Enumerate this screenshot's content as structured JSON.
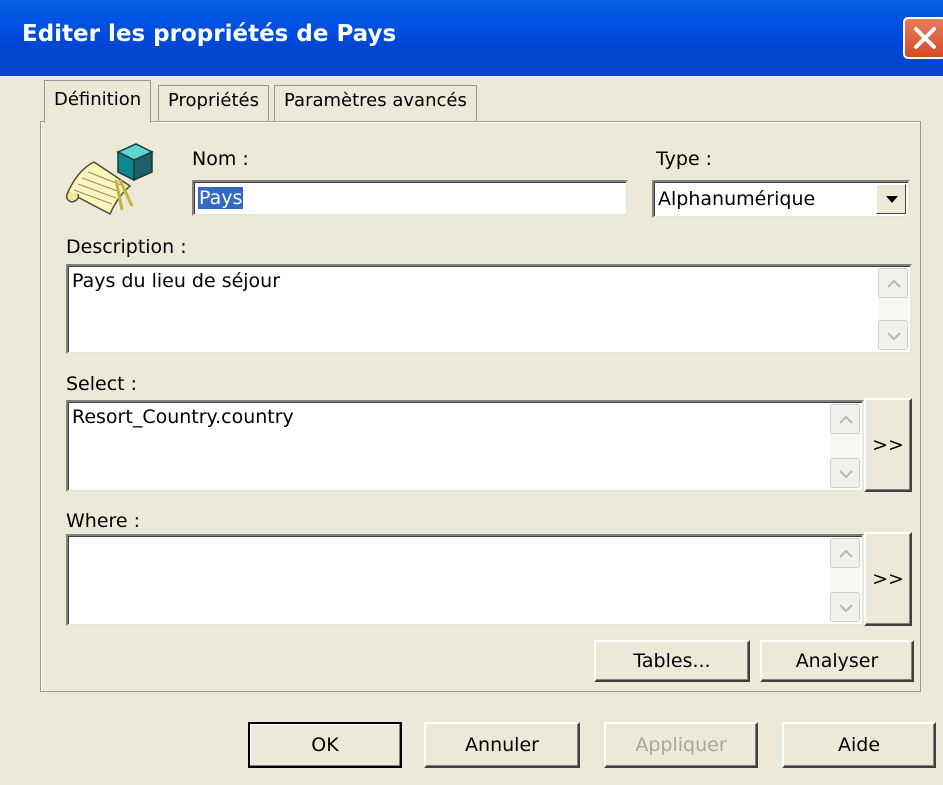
{
  "window": {
    "title": "Editer les propriétés de Pays"
  },
  "tabs": [
    {
      "label": "Définition"
    },
    {
      "label": "Propriétés"
    },
    {
      "label": "Paramètres avancés"
    }
  ],
  "definition": {
    "name_label": "Nom :",
    "name_value": "Pays",
    "type_label": "Type :",
    "type_value": "Alphanumérique",
    "description_label": "Description :",
    "description_value": "Pays du lieu de séjour",
    "select_label": "Select :",
    "select_value": "Resort_Country.country",
    "where_label": "Where :",
    "where_value": "",
    "expand_select_label": ">>",
    "expand_where_label": ">>",
    "tables_button": "Tables...",
    "analyze_button": "Analyser"
  },
  "footer": {
    "ok": "OK",
    "cancel": "Annuler",
    "apply": "Appliquer",
    "help": "Aide"
  },
  "icons": {
    "object_icon": "dimension-object-icon",
    "close": "close-icon"
  }
}
